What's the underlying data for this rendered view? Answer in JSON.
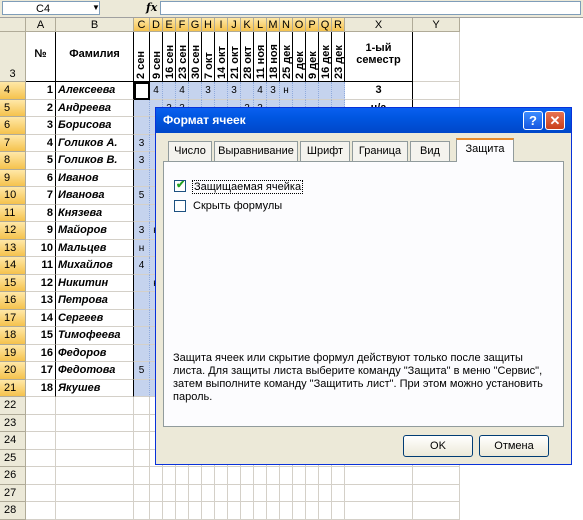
{
  "formula_bar": {
    "name_box": "C4",
    "fx": "fx",
    "value": ""
  },
  "columns": [
    "A",
    "B",
    "C",
    "D",
    "E",
    "F",
    "G",
    "H",
    "I",
    "J",
    "K",
    "L",
    "M",
    "N",
    "O",
    "P",
    "Q",
    "R",
    "X",
    "Y"
  ],
  "header_row": {
    "row_number": "3",
    "num_label": "№",
    "surname_label": "Фамилия",
    "dates": [
      "2 сен",
      "9 сен",
      "16 сен",
      "23 сен",
      "30 сен",
      "7 окт",
      "14 окт",
      "21 окт",
      "28 окт",
      "11 ноя",
      "18 ноя",
      "25 дек",
      "2 дек",
      "9 дек",
      "16 дек",
      "23 дек"
    ],
    "semester_label": "1-ый семестр"
  },
  "rows": [
    {
      "row": "4",
      "num": "1",
      "name": "Алексеева",
      "marks": [
        "",
        "4",
        "",
        "4",
        "",
        "3",
        "",
        "3",
        "",
        "4",
        "3",
        "н",
        "",
        "",
        "",
        ""
      ],
      "sem": "3"
    },
    {
      "row": "5",
      "num": "2",
      "name": "Андреева",
      "marks": [
        "",
        "",
        "3",
        "3",
        "",
        "",
        "",
        "",
        "2",
        "3",
        "",
        "",
        "",
        "",
        "",
        ""
      ],
      "sem": "н/а"
    },
    {
      "row": "6",
      "num": "3",
      "name": "Борисова",
      "marks": [
        "",
        "",
        "",
        "",
        "",
        "",
        "",
        "",
        "",
        "",
        "",
        "",
        "",
        "",
        "",
        ""
      ],
      "sem": ""
    },
    {
      "row": "7",
      "num": "4",
      "name": "Голиков А.",
      "marks": [
        "3",
        "",
        "",
        "",
        "",
        "",
        "",
        "",
        "",
        "",
        "",
        "",
        "",
        "",
        "",
        ""
      ],
      "sem": ""
    },
    {
      "row": "8",
      "num": "5",
      "name": "Голиков В.",
      "marks": [
        "3",
        "",
        "",
        "",
        "",
        "",
        "",
        "",
        "",
        "",
        "",
        "",
        "",
        "",
        "",
        ""
      ],
      "sem": ""
    },
    {
      "row": "9",
      "num": "6",
      "name": "Иванов",
      "marks": [
        "",
        "",
        "",
        "",
        "",
        "",
        "",
        "",
        "",
        "",
        "",
        "",
        "",
        "",
        "",
        ""
      ],
      "sem": ""
    },
    {
      "row": "10",
      "num": "7",
      "name": "Иванова",
      "marks": [
        "5",
        "",
        "",
        "",
        "",
        "",
        "",
        "",
        "",
        "",
        "",
        "",
        "",
        "",
        "",
        ""
      ],
      "sem": ""
    },
    {
      "row": "11",
      "num": "8",
      "name": "Князева",
      "marks": [
        "",
        "",
        "",
        "",
        "",
        "",
        "",
        "",
        "",
        "",
        "",
        "",
        "",
        "",
        "",
        ""
      ],
      "sem": ""
    },
    {
      "row": "12",
      "num": "9",
      "name": "Майоров",
      "marks": [
        "3",
        "н",
        "",
        "",
        "",
        "",
        "",
        "",
        "",
        "",
        "",
        "",
        "",
        "",
        "",
        ""
      ],
      "sem": ""
    },
    {
      "row": "13",
      "num": "10",
      "name": "Мальцев",
      "marks": [
        "н",
        "",
        "",
        "",
        "",
        "",
        "",
        "",
        "",
        "",
        "",
        "",
        "",
        "",
        "",
        ""
      ],
      "sem": ""
    },
    {
      "row": "14",
      "num": "11",
      "name": "Михайлов",
      "marks": [
        "4",
        "",
        "",
        "",
        "",
        "",
        "",
        "",
        "",
        "",
        "",
        "",
        "",
        "",
        "",
        ""
      ],
      "sem": ""
    },
    {
      "row": "15",
      "num": "12",
      "name": "Никитин",
      "marks": [
        "",
        "н",
        "",
        "",
        "",
        "",
        "",
        "",
        "",
        "",
        "",
        "",
        "",
        "",
        "",
        ""
      ],
      "sem": ""
    },
    {
      "row": "16",
      "num": "13",
      "name": "Петрова",
      "marks": [
        "",
        "",
        "",
        "",
        "",
        "",
        "",
        "",
        "",
        "",
        "",
        "",
        "",
        "",
        "",
        ""
      ],
      "sem": ""
    },
    {
      "row": "17",
      "num": "14",
      "name": "Сергеев",
      "marks": [
        "",
        "",
        "",
        "",
        "",
        "",
        "",
        "",
        "",
        "",
        "",
        "",
        "",
        "",
        "",
        ""
      ],
      "sem": ""
    },
    {
      "row": "18",
      "num": "15",
      "name": "Тимофеева",
      "marks": [
        "",
        "",
        "",
        "",
        "",
        "",
        "",
        "",
        "",
        "",
        "",
        "",
        "",
        "",
        "",
        ""
      ],
      "sem": ""
    },
    {
      "row": "19",
      "num": "16",
      "name": "Федоров",
      "marks": [
        "",
        "",
        "",
        "",
        "",
        "",
        "",
        "",
        "",
        "",
        "",
        "",
        "",
        "",
        "",
        ""
      ],
      "sem": ""
    },
    {
      "row": "20",
      "num": "17",
      "name": "Федотова",
      "marks": [
        "5",
        "",
        "",
        "",
        "",
        "",
        "",
        "",
        "",
        "",
        "",
        "",
        "",
        "",
        "",
        ""
      ],
      "sem": ""
    },
    {
      "row": "21",
      "num": "18",
      "name": "Якушев",
      "marks": [
        "",
        "",
        "",
        "",
        "",
        "",
        "",
        "",
        "",
        "",
        "",
        "",
        "",
        "",
        "",
        ""
      ],
      "sem": ""
    }
  ],
  "empty_rows": [
    "22",
    "23",
    "24",
    "25",
    "26",
    "27",
    "28"
  ],
  "dialog": {
    "title": "Формат ячеек",
    "help": "?",
    "close": "✕",
    "tabs": [
      "Число",
      "Выравнивание",
      "Шрифт",
      "Граница",
      "Вид",
      "Защита"
    ],
    "active_tab": "Защита",
    "locked_label": "Защищаемая ячейка",
    "locked_checked": true,
    "hidden_label": "Скрыть формулы",
    "hidden_checked": false,
    "note": "Защита ячеек или скрытие формул действуют только после защиты листа. Для защиты листа выберите команду \"Защита\" в меню \"Сервис\", затем выполните команду \"Защитить лист\". При этом можно установить пароль.",
    "ok": "OK",
    "cancel": "Отмена"
  },
  "colors": {
    "selection": "#c5d3ee",
    "title_bar": "#0054e3",
    "header": "#ece9d8"
  }
}
